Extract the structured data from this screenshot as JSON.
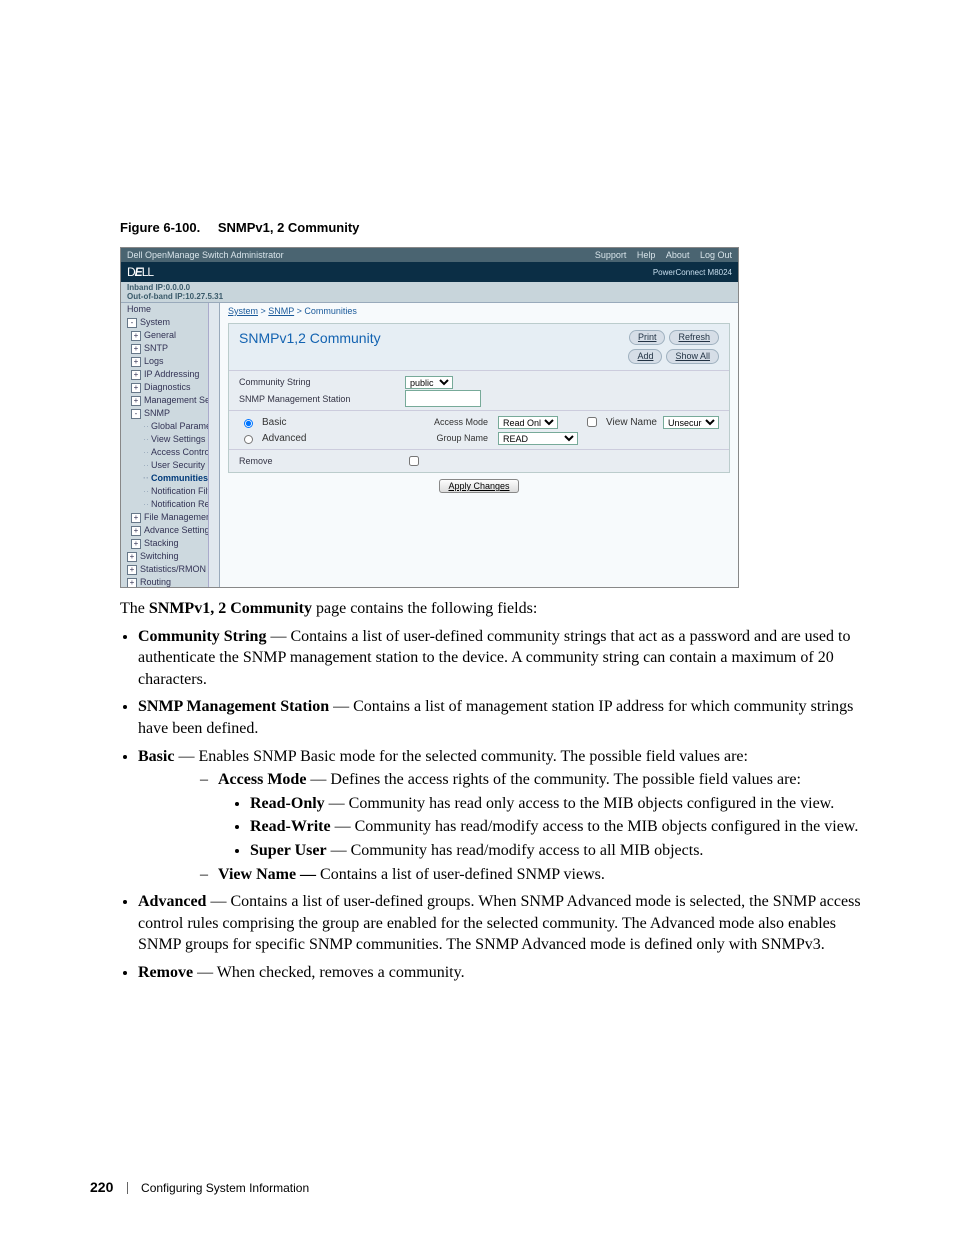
{
  "figure": {
    "label": "Figure 6-100.",
    "title": "SNMPv1, 2 Community"
  },
  "app": {
    "topbar": {
      "title": "Dell OpenManage Switch Administrator",
      "links": [
        "Support",
        "Help",
        "About",
        "Log Out"
      ]
    },
    "brand": {
      "logo": "DELL",
      "model": "PowerConnect M8024"
    },
    "ip": {
      "inband": "Inband IP:0.0.0.0",
      "oob": "Out-of-band IP:10.27.5.31"
    },
    "crumbs": [
      "System",
      "SNMP",
      "Communities"
    ],
    "nav": [
      {
        "t": "Home",
        "lvl": 0
      },
      {
        "t": "System",
        "lvl": 0,
        "box": "-"
      },
      {
        "t": "General",
        "lvl": 1,
        "box": "+"
      },
      {
        "t": "SNTP",
        "lvl": 1,
        "box": "+"
      },
      {
        "t": "Logs",
        "lvl": 1,
        "box": "+"
      },
      {
        "t": "IP Addressing",
        "lvl": 1,
        "box": "+"
      },
      {
        "t": "Diagnostics",
        "lvl": 1,
        "box": "+"
      },
      {
        "t": "Management Secur",
        "lvl": 1,
        "box": "+"
      },
      {
        "t": "SNMP",
        "lvl": 1,
        "box": "-"
      },
      {
        "t": "Global Paramete",
        "lvl": 2
      },
      {
        "t": "View Settings",
        "lvl": 2
      },
      {
        "t": "Access Control (",
        "lvl": 2
      },
      {
        "t": "User Security M",
        "lvl": 2
      },
      {
        "t": "Communities",
        "lvl": 2,
        "sel": true
      },
      {
        "t": "Notification Filter",
        "lvl": 2
      },
      {
        "t": "Notification Recip",
        "lvl": 2
      },
      {
        "t": "File Management",
        "lvl": 1,
        "box": "+"
      },
      {
        "t": "Advance Settings",
        "lvl": 1,
        "box": "+"
      },
      {
        "t": "Stacking",
        "lvl": 1,
        "box": "+"
      },
      {
        "t": "Switching",
        "lvl": 0,
        "box": "+"
      },
      {
        "t": "Statistics/RMON",
        "lvl": 0,
        "box": "+"
      },
      {
        "t": "Routing",
        "lvl": 0,
        "box": "+"
      }
    ],
    "panel": {
      "title": "SNMPv1,2 Community",
      "buttons": {
        "print": "Print",
        "refresh": "Refresh",
        "add": "Add",
        "showall": "Show All"
      },
      "fields": {
        "community_string": {
          "label": "Community String",
          "value": "public"
        },
        "mgmt_station": {
          "label": "SNMP Management Station",
          "value": ""
        },
        "basic": {
          "label": "Basic",
          "checked": true
        },
        "advanced": {
          "label": "Advanced",
          "checked": false
        },
        "access_mode": {
          "label": "Access Mode",
          "value": "Read Only"
        },
        "group_name": {
          "label": "Group Name",
          "value": "READ"
        },
        "view_name": {
          "label": "View Name",
          "value": "Unsecure",
          "checked": false
        },
        "remove": {
          "label": "Remove",
          "checked": false
        },
        "apply": "Apply Changes"
      }
    }
  },
  "body": {
    "intro_pre": "The ",
    "intro_b": "SNMPv1, 2 Community",
    "intro_post": " page contains the following fields:",
    "b_comm": {
      "t": "Community String",
      "d": " — Contains a list of user-defined community strings that act as a password and are used to authenticate the SNMP management station to the device. A community string can contain a maximum of 20 characters."
    },
    "b_mgmt": {
      "t": "SNMP Management Station",
      "d": " — Contains a list of management station IP address for which community strings have been defined."
    },
    "b_basic": {
      "t": "Basic",
      "d": " — Enables SNMP Basic mode for the selected community. The possible field values are:"
    },
    "b_access": {
      "t": "Access Mode",
      "d": " — Defines the access rights of the community. The possible field values are:"
    },
    "b_ro": {
      "t": "Read-Only",
      "d": " — Community has read only access to the MIB objects configured in the view."
    },
    "b_rw": {
      "t": "Read-Write",
      "d": " — Community has read/modify access to the MIB objects configured in the view."
    },
    "b_su": {
      "t": "Super User",
      "d": " — Community has read/modify access to all MIB objects."
    },
    "b_view": {
      "t": "View Name — ",
      "d": "Contains a list of user-defined SNMP views."
    },
    "b_adv": {
      "t": "Advanced",
      "d": " — Contains a list of user-defined groups. When SNMP Advanced mode is selected, the SNMP access control rules comprising the group are enabled for the selected community. The Advanced mode also enables SNMP groups for specific SNMP communities. The SNMP Advanced mode is defined only with SNMPv3."
    },
    "b_rem": {
      "t": "Remove",
      "d": " — When checked, removes a community."
    }
  },
  "folio": {
    "page": "220",
    "section": "Configuring System Information"
  }
}
